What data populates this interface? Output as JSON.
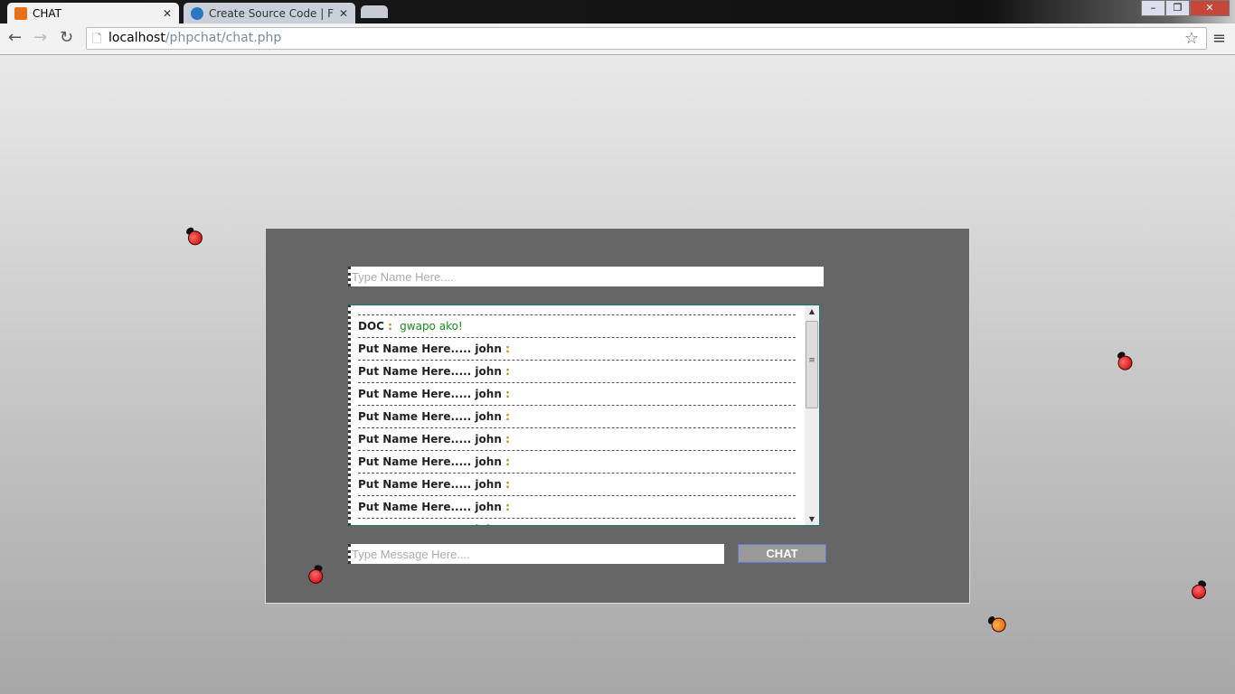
{
  "browser": {
    "tabs": [
      {
        "title": "CHAT",
        "active": true
      },
      {
        "title": "Create Source Code | Free",
        "active": false
      }
    ],
    "url_host": "localhost",
    "url_path": "/phpchat/chat.php"
  },
  "chat": {
    "name_placeholder": "Type Name Here....",
    "message_placeholder": "Type Message Here....",
    "button_label": "CHAT",
    "messages": [
      {
        "name": "DOC",
        "sep": ":",
        "text": "gwapo ako!"
      },
      {
        "name": "Put Name Here..... john",
        "sep": ":",
        "text": ""
      },
      {
        "name": "Put Name Here..... john",
        "sep": ":",
        "text": ""
      },
      {
        "name": "Put Name Here..... john",
        "sep": ":",
        "text": ""
      },
      {
        "name": "Put Name Here..... john",
        "sep": ":",
        "text": ""
      },
      {
        "name": "Put Name Here..... john",
        "sep": ":",
        "text": ""
      },
      {
        "name": "Put Name Here..... john",
        "sep": ":",
        "text": ""
      },
      {
        "name": "Put Name Here..... john",
        "sep": ":",
        "text": ""
      },
      {
        "name": "Put Name Here..... john",
        "sep": ":",
        "text": ""
      },
      {
        "name": "Put Name Here..... john",
        "sep": ":",
        "text": ""
      }
    ]
  },
  "colors": {
    "panel": "#666666",
    "message_text": "#1a8a1a",
    "button": "#999999"
  }
}
